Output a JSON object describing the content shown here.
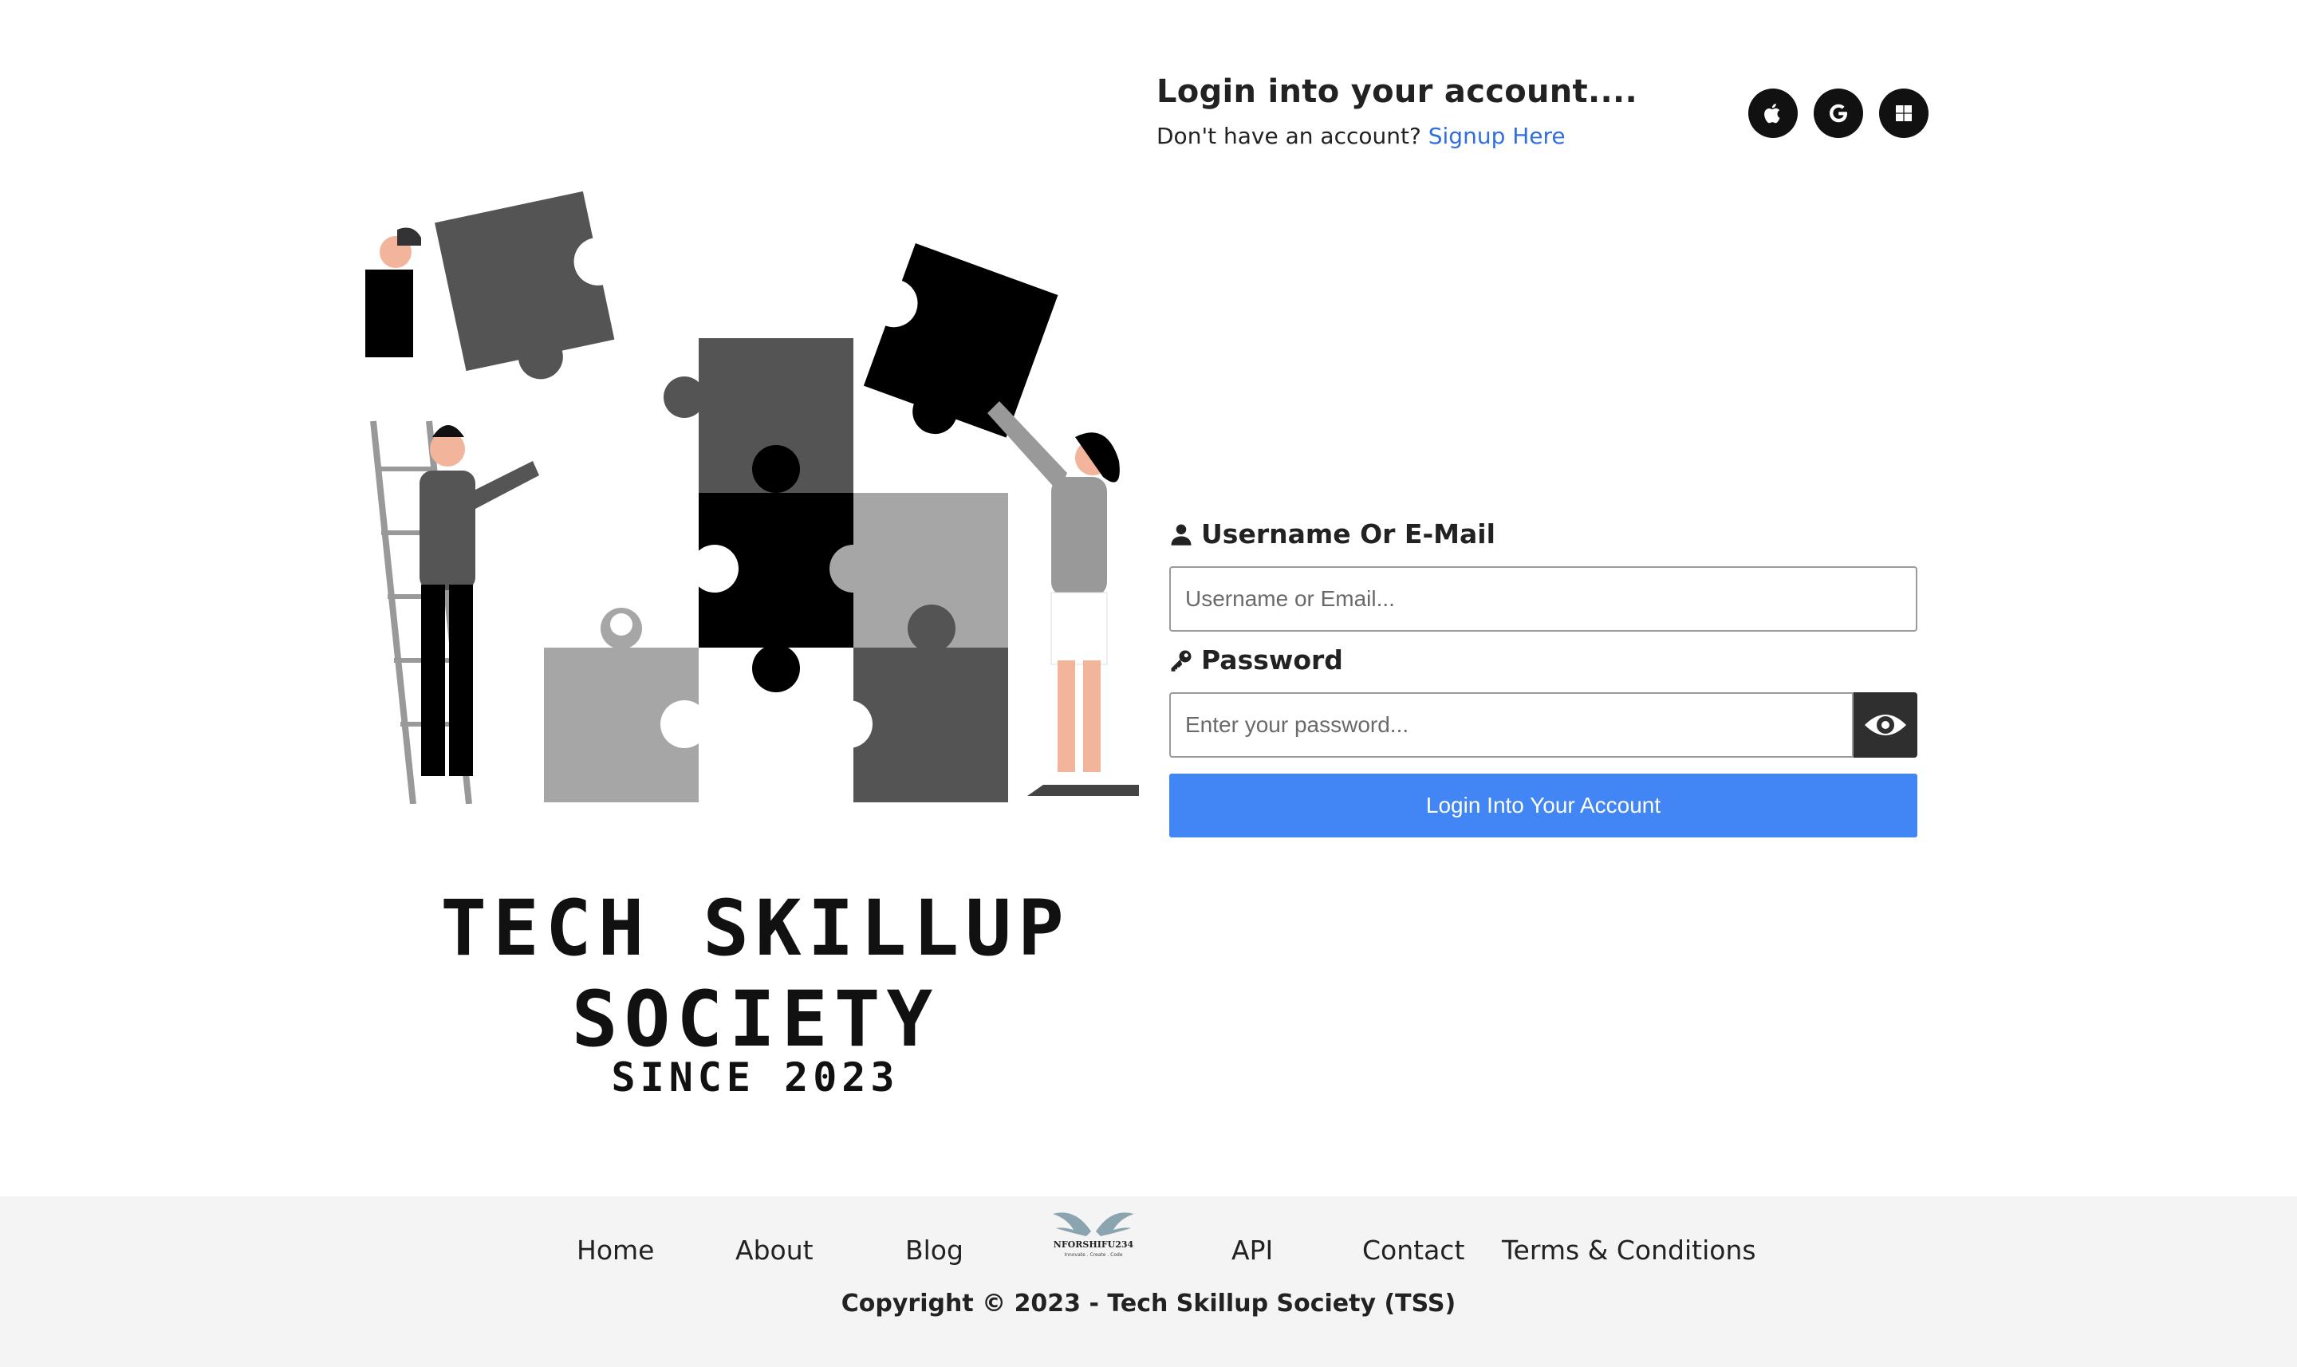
{
  "header": {
    "title": "Login into your account....",
    "subtitle_prefix": "Don't have an account?",
    "signup_link": "Signup Here"
  },
  "social": [
    {
      "icon": "apple-icon"
    },
    {
      "icon": "google-icon"
    },
    {
      "icon": "windows-icon"
    }
  ],
  "brand": {
    "line1": "TECH SKILLUP",
    "line2": "SOCIETY",
    "line3": "SINCE 2023"
  },
  "form": {
    "username_label": "Username Or E-Mail",
    "username_placeholder": "Username or Email...",
    "password_label": "Password",
    "password_placeholder": "Enter your password...",
    "submit_label": "Login Into Your Account"
  },
  "footer": {
    "nav": {
      "home": "Home",
      "about": "About",
      "blog": "Blog",
      "api": "API",
      "contact": "Contact",
      "terms": "Terms & Conditions"
    },
    "logo_text": "NFORSHIFU234",
    "logo_tagline": "Innovate . Create . Code",
    "copyright": "Copyright © 2023 - Tech Skillup Society (TSS)"
  },
  "colors": {
    "accent": "#4285f4",
    "link": "#2f6fe0",
    "footer_bg": "#f4f4f4",
    "eye_button": "#2f2f2f"
  }
}
